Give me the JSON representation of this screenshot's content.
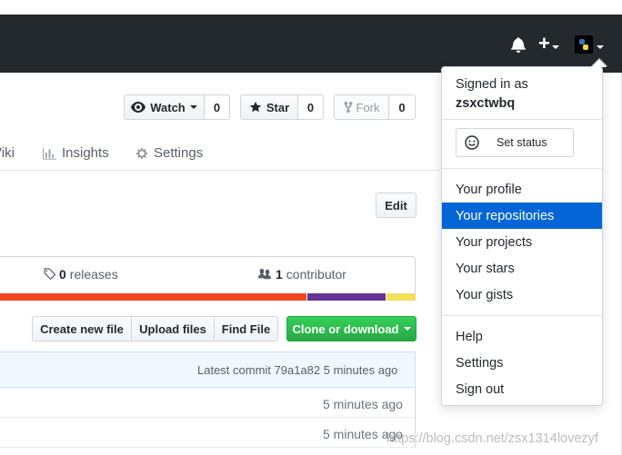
{
  "header": {
    "bell_icon": "bell-icon",
    "plus_icon": "plus-icon",
    "avatar_icon": "python-avatar-icon"
  },
  "repo_actions": {
    "watch_label": "Watch",
    "watch_count": "0",
    "star_label": "Star",
    "star_count": "0",
    "fork_label": "Fork",
    "fork_count": "0"
  },
  "tabs": {
    "wiki_partial": "Viki",
    "insights": "Insights",
    "settings": "Settings"
  },
  "description": {
    "edit_label": "Edit"
  },
  "summary": {
    "releases_count": "0",
    "releases_label": "releases",
    "contributors_count": "1",
    "contributors_label": "contributor",
    "language_colors": [
      "#f1471d",
      "#663399",
      "#f1e05a"
    ],
    "language_fractions": [
      0.74,
      0.19,
      0.07
    ]
  },
  "file_actions": {
    "create_new_file": "Create new file",
    "upload_files": "Upload files",
    "find_file": "Find File",
    "clone_or_download": "Clone or download"
  },
  "commit": {
    "latest_text": "Latest commit 79a1a82 5 minutes ago"
  },
  "rows": [
    {
      "time": "5 minutes ago"
    },
    {
      "time": "5 minutes ago"
    }
  ],
  "dropdown": {
    "signed_in_as": "Signed in as",
    "username": "zsxctwbq",
    "set_status": "Set status",
    "items_group1": [
      "Your profile",
      "Your repositories",
      "Your projects",
      "Your stars",
      "Your gists"
    ],
    "items_group2": [
      "Help",
      "Settings",
      "Sign out"
    ],
    "active_item": "Your repositories"
  },
  "watermark": "https://blog.csdn.net/zsx1314lovezyf",
  "colors": {
    "header_bg": "#24292e",
    "accent_blue": "#0366d6",
    "clone_green": "#28a745"
  }
}
